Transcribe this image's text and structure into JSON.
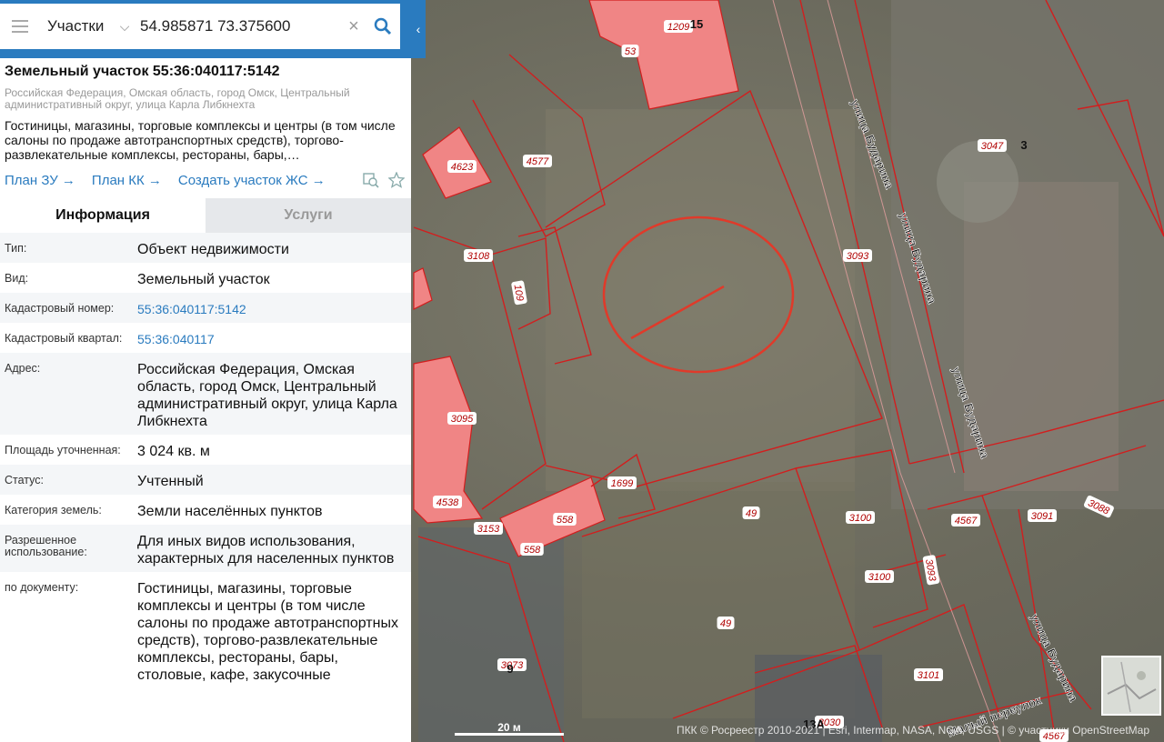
{
  "search": {
    "type": "Участки",
    "value": "54.985871 73.375600"
  },
  "object": {
    "title": "Земельный участок 55:36:040117:5142",
    "address": "Российская Федерация, Омская область, город Омск, Центральный административный округ, улица Карла Либкнехта",
    "purpose": "Гостиницы, магазины, торговые комплексы и центры (в том числе салоны по продаже автотранспортных средств), торгово-развлекательные комплексы, рестораны, бары,…"
  },
  "links": {
    "plan_zu": "План ЗУ",
    "plan_kk": "План КК",
    "create_zs": "Создать участок ЖС"
  },
  "tabs": {
    "info": "Информация",
    "services": "Услуги"
  },
  "info": [
    {
      "key": "Тип:",
      "value": "Объект недвижимости"
    },
    {
      "key": "Вид:",
      "value": "Земельный участок"
    },
    {
      "key": "Кадастровый номер:",
      "value": "55:36:040117:5142"
    },
    {
      "key": "Кадастровый квартал:",
      "value": "55:36:040117"
    },
    {
      "key": "Адрес:",
      "value": "Российская Федерация, Омская область, город Омск, Центральный административный округ, улица Карла Либкнехта"
    },
    {
      "key": "Площадь уточненная:",
      "value": "3 024 кв. м"
    },
    {
      "key": "Статус:",
      "value": "Учтенный"
    },
    {
      "key": "Категория земель:",
      "value": "Земли населённых пунктов"
    },
    {
      "key": "Разрешенное использование:",
      "value": "Для иных видов использования, характерных для населенных пунктов"
    },
    {
      "key": "по документу:",
      "value": "Гостиницы, магазины, торговые комплексы и центры (в том числе салоны по продаже автотранспортных средств), торгово-развлекательные комплексы, рестораны, бары, столовые, кафе, закусочные"
    }
  ],
  "map": {
    "parcel_labels": [
      "1209",
      "53",
      "4623",
      "4577",
      "3108",
      "109",
      "3047",
      "3093",
      "3095",
      "1699",
      "4538",
      "558",
      "558",
      "3153",
      "49",
      "3100",
      "3100",
      "3093",
      "4567",
      "3091",
      "3088",
      "49",
      "3073",
      "3101",
      "3030",
      "4567"
    ],
    "building_numbers": [
      "15",
      "3",
      "9",
      "13А"
    ],
    "streets": [
      "улица Бударина",
      "улица Бударина",
      "улица Бударина",
      "улица Бударина",
      "Малый переулок"
    ],
    "scale": "20 м",
    "attribution": "ПКК © Росреестр 2010-2021 | Esri, Intermap, NASA, NGA, USGS | © участники OpenStreetMap"
  },
  "colors": {
    "accent": "#2a7bbf",
    "parcel_line": "#d21e1e",
    "selected_fill": "#f08080"
  }
}
